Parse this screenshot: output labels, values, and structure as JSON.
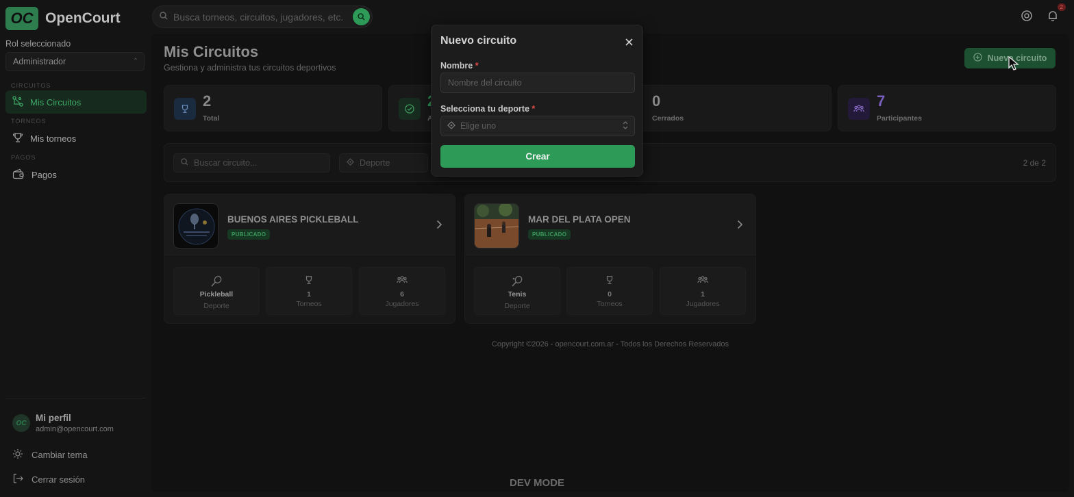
{
  "app": {
    "name": "OpenCourt",
    "logo_mark": "OC"
  },
  "search": {
    "placeholder": "Busca torneos, circuitos, jugadores, etc."
  },
  "header": {
    "notification_count": "2"
  },
  "sidebar": {
    "role_label": "Rol seleccionado",
    "role_value": "Administrador",
    "sections": [
      {
        "label": "CIRCUITOS",
        "item": "Mis Circuitos"
      },
      {
        "label": "TORNEOS",
        "item": "Mis torneos"
      },
      {
        "label": "PAGOS",
        "item": "Pagos"
      }
    ],
    "profile": {
      "name": "Mi perfil",
      "email": "admin@opencourt.com"
    },
    "theme_label": "Cambiar tema",
    "logout_label": "Cerrar sesión"
  },
  "page": {
    "title": "Mis Circuitos",
    "subtitle": "Gestiona y administra tus circuitos deportivos",
    "new_button": "Nuevo circuito"
  },
  "stats": [
    {
      "value": "2",
      "label": "Total",
      "color": "#1e3a5f"
    },
    {
      "value": "2",
      "label": "A",
      "color": "#173823"
    },
    {
      "value": "0",
      "label": "Cerrados",
      "color": "#3a1e1e"
    },
    {
      "value": "7",
      "label": "Participantes",
      "color": "#2a1d45"
    }
  ],
  "filters": {
    "search_placeholder": "Buscar circuito...",
    "sport_placeholder": "Deporte",
    "count": "2 de 2"
  },
  "circuits": [
    {
      "title": "BUENOS AIRES PICKLEBALL",
      "status": "PUBLICADO",
      "sport": "Pickleball",
      "sport_label": "Deporte",
      "tournaments": "1",
      "tournaments_label": "Torneos",
      "players": "6",
      "players_label": "Jugadores"
    },
    {
      "title": "MAR DEL PLATA OPEN",
      "status": "PUBLICADO",
      "sport": "Tenis",
      "sport_label": "Deporte",
      "tournaments": "0",
      "tournaments_label": "Torneos",
      "players": "1",
      "players_label": "Jugadores"
    }
  ],
  "footer": {
    "copyright": "Copyright ©2026 - opencourt.com.ar - Todos los Derechos Reservados"
  },
  "dev_mode": "DEV MODE",
  "modal": {
    "title": "Nuevo circuito",
    "name_label": "Nombre",
    "name_placeholder": "Nombre del circuito",
    "sport_label": "Selecciona tu deporte",
    "sport_placeholder": "Elige uno",
    "required_mark": "*",
    "submit": "Crear"
  },
  "colors": {
    "accent": "#2e9a57",
    "background": "#141414"
  }
}
